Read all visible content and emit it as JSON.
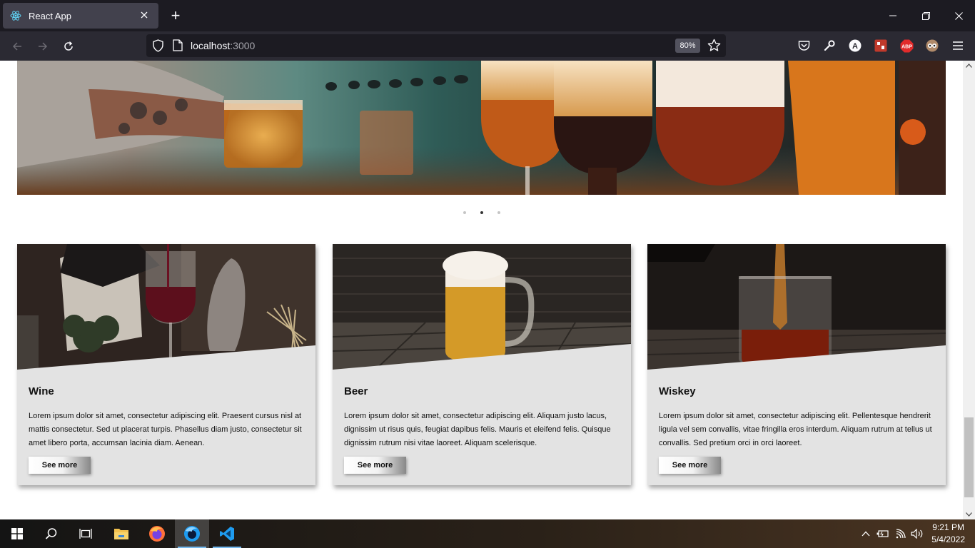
{
  "browser": {
    "tab_title": "React App",
    "new_tab_symbol": "+",
    "url_host": "localhost",
    "url_port": ":3000",
    "zoom": "80%"
  },
  "carousel": {
    "slide_count": 3,
    "active_index": 1
  },
  "cards": [
    {
      "title": "Wine",
      "text": "Lorem ipsum dolor sit amet, consectetur adipiscing elit. Praesent cursus nisl at mattis consectetur. Sed ut placerat turpis. Phasellus diam justo, consectetur sit amet libero porta, accumsan lacinia diam. Aenean.",
      "button": "See more"
    },
    {
      "title": "Beer",
      "text": "Lorem ipsum dolor sit amet, consectetur adipiscing elit. Aliquam justo lacus, dignissim ut risus quis, feugiat dapibus felis. Mauris et eleifend felis. Quisque dignissim rutrum nisi vitae laoreet. Aliquam scelerisque.",
      "button": "See more"
    },
    {
      "title": "Wiskey",
      "text": "Lorem ipsum dolor sit amet, consectetur adipiscing elit. Pellentesque hendrerit ligula vel sem convallis, vitae fringilla eros interdum. Aliquam rutrum at tellus ut convallis. Sed pretium orci in orci laoreet.",
      "button": "See more"
    }
  ],
  "taskbar": {
    "time": "9:21 PM",
    "date": "5/4/2022"
  },
  "icons": [
    "react-icon",
    "close-icon",
    "minimize-icon",
    "restore-icon",
    "back-icon",
    "forward-icon",
    "reload-icon",
    "shield-icon",
    "page-icon",
    "star-icon",
    "pocket-icon",
    "wrench-icon",
    "a-extension-icon",
    "ublock-icon",
    "abp-icon",
    "owl-extension-icon",
    "menu-icon",
    "windows-start-icon",
    "search-icon",
    "task-view-icon",
    "file-explorer-icon",
    "firefox-icon",
    "firefox-dev-icon",
    "vscode-icon",
    "chevron-up-icon",
    "battery-icon",
    "wifi-icon",
    "volume-icon"
  ]
}
